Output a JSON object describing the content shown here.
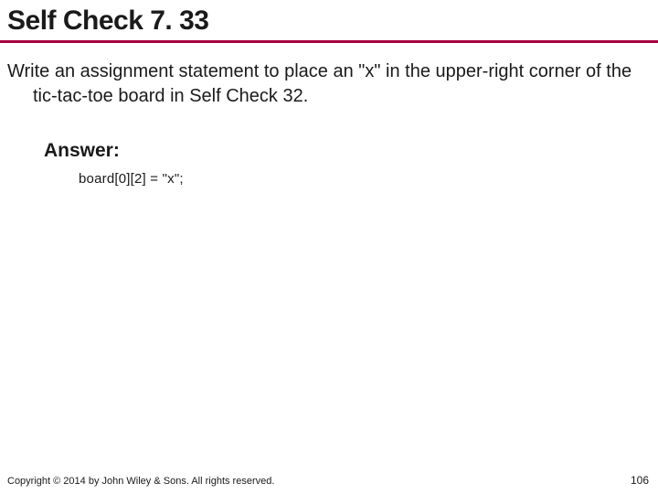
{
  "title": "Self Check 7. 33",
  "question": "Write an assignment statement to place an \"x\" in the upper-right corner of the tic-tac-toe board in Self Check 32.",
  "answer_label": "Answer:",
  "answer_code": "board[0][2] = \"x\";",
  "copyright": "Copyright © 2014 by John Wiley & Sons. All rights reserved.",
  "page_number": "106"
}
